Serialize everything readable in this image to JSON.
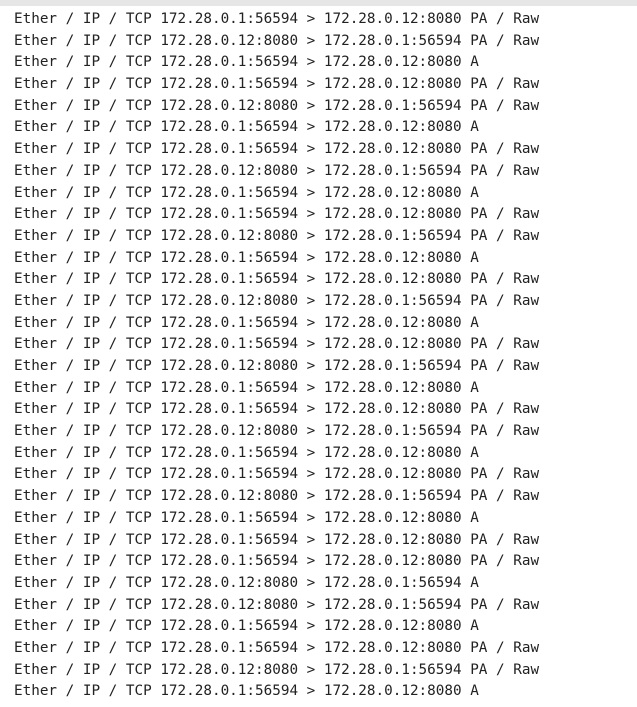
{
  "output": {
    "lines": [
      "Ether / IP / TCP 172.28.0.1:56594 > 172.28.0.12:8080 PA / Raw",
      "Ether / IP / TCP 172.28.0.12:8080 > 172.28.0.1:56594 PA / Raw",
      "Ether / IP / TCP 172.28.0.1:56594 > 172.28.0.12:8080 A",
      "Ether / IP / TCP 172.28.0.1:56594 > 172.28.0.12:8080 PA / Raw",
      "Ether / IP / TCP 172.28.0.12:8080 > 172.28.0.1:56594 PA / Raw",
      "Ether / IP / TCP 172.28.0.1:56594 > 172.28.0.12:8080 A",
      "Ether / IP / TCP 172.28.0.1:56594 > 172.28.0.12:8080 PA / Raw",
      "Ether / IP / TCP 172.28.0.12:8080 > 172.28.0.1:56594 PA / Raw",
      "Ether / IP / TCP 172.28.0.1:56594 > 172.28.0.12:8080 A",
      "Ether / IP / TCP 172.28.0.1:56594 > 172.28.0.12:8080 PA / Raw",
      "Ether / IP / TCP 172.28.0.12:8080 > 172.28.0.1:56594 PA / Raw",
      "Ether / IP / TCP 172.28.0.1:56594 > 172.28.0.12:8080 A",
      "Ether / IP / TCP 172.28.0.1:56594 > 172.28.0.12:8080 PA / Raw",
      "Ether / IP / TCP 172.28.0.12:8080 > 172.28.0.1:56594 PA / Raw",
      "Ether / IP / TCP 172.28.0.1:56594 > 172.28.0.12:8080 A",
      "Ether / IP / TCP 172.28.0.1:56594 > 172.28.0.12:8080 PA / Raw",
      "Ether / IP / TCP 172.28.0.12:8080 > 172.28.0.1:56594 PA / Raw",
      "Ether / IP / TCP 172.28.0.1:56594 > 172.28.0.12:8080 A",
      "Ether / IP / TCP 172.28.0.1:56594 > 172.28.0.12:8080 PA / Raw",
      "Ether / IP / TCP 172.28.0.12:8080 > 172.28.0.1:56594 PA / Raw",
      "Ether / IP / TCP 172.28.0.1:56594 > 172.28.0.12:8080 A",
      "Ether / IP / TCP 172.28.0.1:56594 > 172.28.0.12:8080 PA / Raw",
      "Ether / IP / TCP 172.28.0.12:8080 > 172.28.0.1:56594 PA / Raw",
      "Ether / IP / TCP 172.28.0.1:56594 > 172.28.0.12:8080 A",
      "Ether / IP / TCP 172.28.0.1:56594 > 172.28.0.12:8080 PA / Raw",
      "Ether / IP / TCP 172.28.0.1:56594 > 172.28.0.12:8080 PA / Raw",
      "Ether / IP / TCP 172.28.0.12:8080 > 172.28.0.1:56594 A",
      "Ether / IP / TCP 172.28.0.12:8080 > 172.28.0.1:56594 PA / Raw",
      "Ether / IP / TCP 172.28.0.1:56594 > 172.28.0.12:8080 A",
      "Ether / IP / TCP 172.28.0.1:56594 > 172.28.0.12:8080 PA / Raw",
      "Ether / IP / TCP 172.28.0.12:8080 > 172.28.0.1:56594 PA / Raw",
      "Ether / IP / TCP 172.28.0.1:56594 > 172.28.0.12:8080 A"
    ]
  },
  "colors": {
    "text": "#222222",
    "background": "#ffffff",
    "top_bar": "#e6e6e6"
  }
}
